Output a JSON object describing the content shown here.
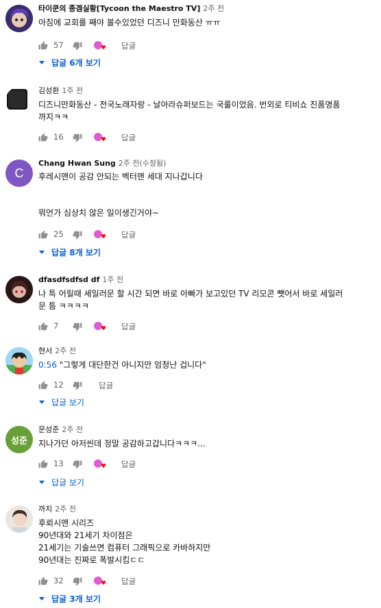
{
  "comments": [
    {
      "author": "타이쿤의 종겜실황[Tycoon the Maestro TV]",
      "time": "2주 전",
      "lines": [
        "아침에 교회를 째야 볼수있었던 디즈니 만화동산 ㅠㅠ"
      ],
      "likes": "57",
      "reply": "답글",
      "replies": "답글 6개 보기"
    },
    {
      "author": "김성환",
      "time": "1주 전",
      "lines": [
        "디즈니만화동산 - 전국노래자랑 - 날아라슈퍼보드는 국룰이었음. 번외로 티비쇼 진품명품",
        "까지ㅋㅋ"
      ],
      "likes": "16",
      "reply": "답글"
    },
    {
      "author": "Chang Hwan Sung",
      "time": "2주 전(수정됨)",
      "lines": [
        "후레시맨이 공감 안되는 벡터맨 세대 지나갑니다",
        "",
        "",
        "뭐언가 심상치 않은 일이생긴거야~"
      ],
      "likes": "25",
      "reply": "답글",
      "replies": "답글 8개 보기",
      "avatar_letter": "C"
    },
    {
      "author": "dfasdfsdfsd df",
      "time": "1주 전",
      "lines": [
        "나 특 어릴때 세일러문 할 시간 되면 바로 아빠가 보고있던 TV 리모콘 뺏어서 바로 세일러",
        "문 틈 ㅋㅋㅋㅋ"
      ],
      "likes": "7",
      "reply": "답글"
    },
    {
      "author": "현서",
      "time": "2주 전",
      "timestamp": "0:56",
      "lines": [
        " \"그렇게 대단한건 아니지만 엄청난 겁니다\""
      ],
      "likes": "12",
      "reply": "답글",
      "replies": "답글 보기"
    },
    {
      "author": "문성준",
      "time": "2주 전",
      "lines": [
        "지나가던 아저씬데 정말 공감하고갑니다ㅋㅋㅋ..."
      ],
      "likes": "13",
      "reply": "답글",
      "replies": "답글 보기",
      "avatar_letter": "성준"
    },
    {
      "author": "까치",
      "time": "2주 전",
      "lines": [
        "후뢰시맨 시리즈",
        "90년대와 21세기 차이점은",
        "21세기는 기술쓰면 컴퓨터 그래픽으로 카바하지만",
        "90년대는 진짜로 폭발시킴ㄷㄷ"
      ],
      "likes": "32",
      "reply": "답글",
      "replies": "답글 3개 보기"
    }
  ],
  "colors": {
    "link": "#065fd4",
    "meta": "#606060",
    "heart": "#ff0000"
  }
}
